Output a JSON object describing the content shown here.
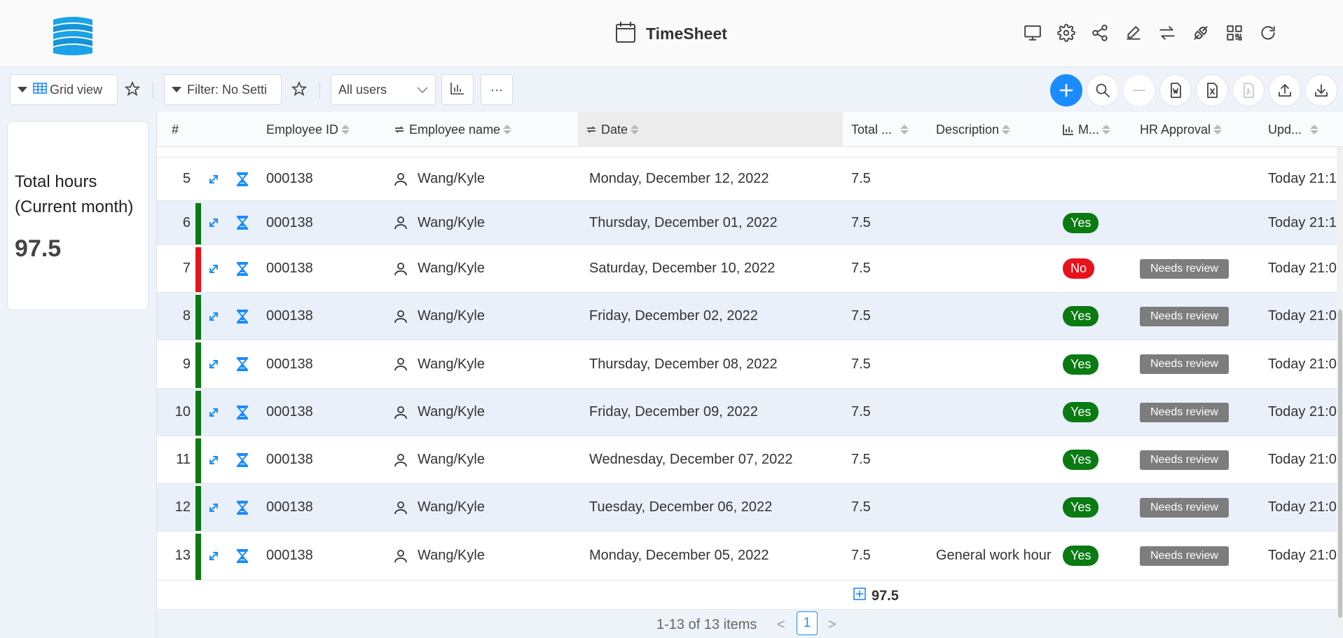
{
  "app": {
    "title": "TimeSheet"
  },
  "header_icons": [
    "monitor-icon",
    "gear-icon",
    "share-icon",
    "edit-icon",
    "swap-icon",
    "plug-icon",
    "qr-code-icon",
    "refresh-icon"
  ],
  "toolbar": {
    "view_label": "Grid view",
    "filter_label": "Filter: No Setti",
    "users_select": "All users",
    "more_label": "···"
  },
  "card": {
    "title": "Total hours (Current month)",
    "value": "97.5"
  },
  "columns": {
    "num": "#",
    "employee_id": "Employee ID",
    "employee_name": "Employee name",
    "date": "Date",
    "total": "Total ...",
    "description": "Description",
    "m": "M...",
    "hr_approval": "HR Approval",
    "updated": "Upd..."
  },
  "rows": [
    {
      "num": "5",
      "status": "none",
      "id": "000138",
      "name": "Wang/Kyle",
      "date": "Monday, December 12, 2022",
      "total": "7.5",
      "description": "",
      "m": "",
      "hr": "",
      "updated": "Today 21:1"
    },
    {
      "num": "6",
      "status": "green",
      "id": "000138",
      "name": "Wang/Kyle",
      "date": "Thursday, December 01, 2022",
      "total": "7.5",
      "description": "",
      "m": "Yes",
      "hr": "",
      "updated": "Today 21:1"
    },
    {
      "num": "7",
      "status": "red",
      "id": "000138",
      "name": "Wang/Kyle",
      "date": "Saturday, December 10, 2022",
      "total": "7.5",
      "description": "",
      "m": "No",
      "hr": "Needs review",
      "updated": "Today 21:0"
    },
    {
      "num": "8",
      "status": "green",
      "id": "000138",
      "name": "Wang/Kyle",
      "date": "Friday, December 02, 2022",
      "total": "7.5",
      "description": "",
      "m": "Yes",
      "hr": "Needs review",
      "updated": "Today 21:0"
    },
    {
      "num": "9",
      "status": "green",
      "id": "000138",
      "name": "Wang/Kyle",
      "date": "Thursday, December 08, 2022",
      "total": "7.5",
      "description": "",
      "m": "Yes",
      "hr": "Needs review",
      "updated": "Today 21:0"
    },
    {
      "num": "10",
      "status": "green",
      "id": "000138",
      "name": "Wang/Kyle",
      "date": "Friday, December 09, 2022",
      "total": "7.5",
      "description": "",
      "m": "Yes",
      "hr": "Needs review",
      "updated": "Today 21:0"
    },
    {
      "num": "11",
      "status": "green",
      "id": "000138",
      "name": "Wang/Kyle",
      "date": "Wednesday, December 07, 2022",
      "total": "7.5",
      "description": "",
      "m": "Yes",
      "hr": "Needs review",
      "updated": "Today 21:0"
    },
    {
      "num": "12",
      "status": "green",
      "id": "000138",
      "name": "Wang/Kyle",
      "date": "Tuesday, December 06, 2022",
      "total": "7.5",
      "description": "",
      "m": "Yes",
      "hr": "Needs review",
      "updated": "Today 21:0"
    },
    {
      "num": "13",
      "status": "green",
      "id": "000138",
      "name": "Wang/Kyle",
      "date": "Monday, December 05, 2022",
      "total": "7.5",
      "description": "General work hour",
      "m": "Yes",
      "hr": "Needs review",
      "updated": "Today 21:0"
    }
  ],
  "footer": {
    "sum": "97.5"
  },
  "pager": {
    "info": "1-13 of 13 items",
    "current": "1",
    "prev": "<",
    "next": ">"
  },
  "colors": {
    "accent": "#1a8cff",
    "yes": "#0a7a12",
    "no": "#e8121b",
    "status_green": "#0a7a12",
    "status_red": "#e8121b",
    "badge": "#7d7d7d",
    "row_alt": "#eaf0f9"
  }
}
